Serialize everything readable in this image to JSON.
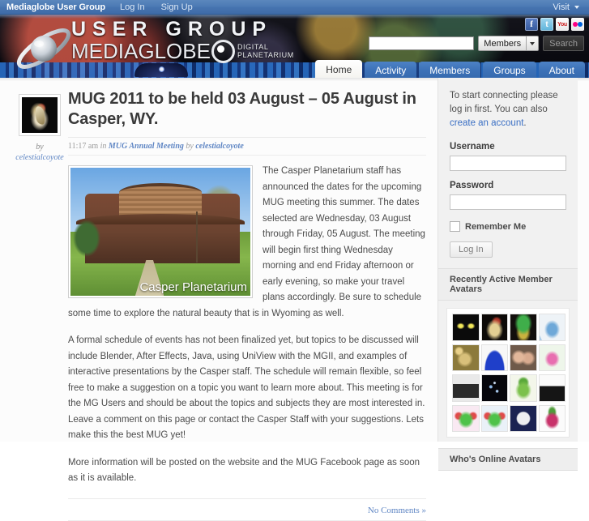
{
  "adminbar": {
    "brand": "Mediaglobe User Group",
    "login": "Log In",
    "signup": "Sign Up",
    "visit": "Visit",
    "caret_icon": "chevron-down-icon"
  },
  "banner": {
    "logo_line1": "USER GROUP",
    "logo_line2": "MEDIAGLOBE",
    "logo_tag_line1": "DIGITAL",
    "logo_tag_line2": "PLANETARIUM",
    "social": [
      {
        "name": "facebook-icon",
        "glyph": "f"
      },
      {
        "name": "twitter-icon",
        "glyph": "t"
      },
      {
        "name": "youtube-icon",
        "glyph": "You"
      },
      {
        "name": "flickr-icon",
        "glyph": ""
      }
    ]
  },
  "search": {
    "value": "",
    "placeholder": "",
    "scope_selected": "Members",
    "button_label": "Search"
  },
  "nav": {
    "tabs": [
      {
        "label": "Home",
        "active": true
      },
      {
        "label": "Activity",
        "active": false
      },
      {
        "label": "Members",
        "active": false
      },
      {
        "label": "Groups",
        "active": false
      },
      {
        "label": "About",
        "active": false
      }
    ]
  },
  "post": {
    "author_by": "by",
    "author": "celestialcoyote",
    "title": "MUG 2011 to be held 03 August – 05 August in Casper, WY.",
    "meta_time": "11:17 am",
    "meta_in": "in",
    "meta_category": "MUG Annual Meeting",
    "meta_by": "by",
    "meta_author": "celestialcoyote",
    "photo_caption": "Casper Planetarium",
    "paragraph1": "The Casper Planetarium staff has announced the dates for the upcoming MUG meeting this summer.  The dates selected are Wednesday, 03 August through Friday, 05 August.  The meeting will begin first thing Wednesday morning and end Friday afternoon or early evening, so make your travel plans accordingly.  Be sure to schedule some time to explore the natural beauty that is in Wyoming as well.",
    "paragraph2": "A formal schedule of events has not been finalized yet, but topics to be discussed will include Blender, After Effects, Java, using UniView with the MGII, and examples of interactive presentations by the Casper staff.  The schedule will remain flexible, so feel free to make a suggestion on a topic you want to learn more about.  This meeting is for the MG Users and should be about the topics and subjects they are most interested in.  Leave a comment on this page or contact the Casper Staff with your suggestions.  Lets make this the best MUG yet!",
    "paragraph3": "More information will be posted on the website and the MUG Facebook page as soon as it is available.",
    "comments_link": "No Comments »"
  },
  "sidebar": {
    "intro_part1": "To start connecting please log in first. You can also ",
    "intro_link": "create an account",
    "intro_part2": ".",
    "username_label": "Username",
    "username_value": "",
    "password_label": "Password",
    "password_value": "",
    "remember_label": "Remember Me",
    "login_button": "Log In",
    "widget1_title": "Recently Active Member Avatars",
    "widget2_title": "Who's Online Avatars",
    "avatars": [
      {
        "name": "avatar-cat-eyes",
        "bg": "#0b0b0b"
      },
      {
        "name": "avatar-flame",
        "bg": "#0d0a08"
      },
      {
        "name": "avatar-marvin-martian",
        "bg": "#120f0c"
      },
      {
        "name": "avatar-blue-bug",
        "bg": "#eef3f7"
      },
      {
        "name": "avatar-person-gold",
        "bg": "#8c7a3c"
      },
      {
        "name": "avatar-blue-dome",
        "bg": "#f7f7f7"
      },
      {
        "name": "avatar-two-people",
        "bg": "#6f5a4a"
      },
      {
        "name": "avatar-pink-creature",
        "bg": "#eef6ea"
      },
      {
        "name": "avatar-truck",
        "bg": "#e9e9e9"
      },
      {
        "name": "avatar-stars-night",
        "bg": "#06060c"
      },
      {
        "name": "avatar-green-alien",
        "bg": "#f3f6ea"
      },
      {
        "name": "avatar-mug-cup",
        "bg": "#fafafa"
      },
      {
        "name": "avatar-green-monster-pink",
        "bg": "#f9e9f2"
      },
      {
        "name": "avatar-green-monster-blue",
        "bg": "#eaf1f8"
      },
      {
        "name": "avatar-geek-inside",
        "bg": "#1b2352"
      },
      {
        "name": "avatar-raspberry",
        "bg": "#fbfbfb"
      }
    ]
  },
  "colors": {
    "accent_blue": "#3d72b8",
    "link_blue": "#5f86c4",
    "adminbar_blue": "#4674b0",
    "sidebar_gray": "#f1f1f1"
  }
}
